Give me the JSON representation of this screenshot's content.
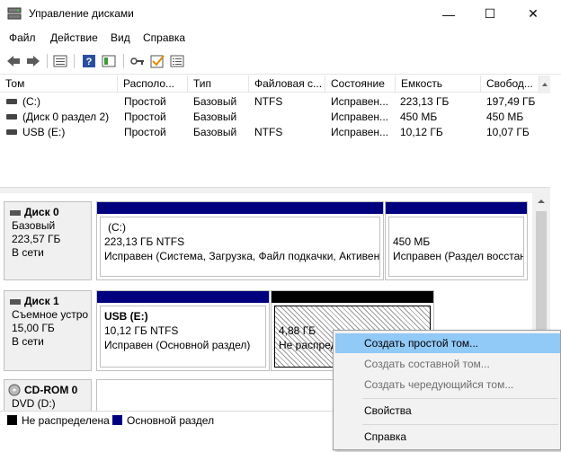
{
  "window": {
    "title": "Управление дисками",
    "minimize": "—",
    "maximize": "☐",
    "close": "✕"
  },
  "menu": [
    "Файл",
    "Действие",
    "Вид",
    "Справка"
  ],
  "toolbar": [
    "back-icon",
    "forward-icon",
    "properties-icon",
    "help-icon",
    "view-icon",
    "key-icon",
    "check-icon",
    "list-icon"
  ],
  "columns": [
    "Том",
    "Располо...",
    "Тип",
    "Файловая с...",
    "Состояние",
    "Емкость",
    "Свобод..."
  ],
  "volumes": [
    [
      "(C:)",
      "Простой",
      "Базовый",
      "NTFS",
      "Исправен...",
      "223,13 ГБ",
      "197,49 ГБ"
    ],
    [
      "(Диск 0 раздел 2)",
      "Простой",
      "Базовый",
      "",
      "Исправен...",
      "450 МБ",
      "450 МБ"
    ],
    [
      "USB (E:)",
      "Простой",
      "Базовый",
      "NTFS",
      "Исправен...",
      "10,12 ГБ",
      "10,07 ГБ"
    ]
  ],
  "disks": {
    "disk0": {
      "name": "Диск 0",
      "type": "Базовый",
      "size": "223,57 ГБ",
      "status": "В сети"
    },
    "disk1": {
      "name": "Диск 1",
      "type": "Съемное устро",
      "size": "15,00 ГБ",
      "status": "В сети"
    },
    "cdrom": {
      "name": "CD-ROM 0",
      "type": "DVD (D:)"
    }
  },
  "partitions": {
    "c": {
      "label": "(C:)",
      "fs": "223,13 ГБ NTFS",
      "status": "Исправен (Система, Загрузка, Файл подкачки, Активен,"
    },
    "p2": {
      "label": "",
      "fs": "450 МБ",
      "status": "Исправен (Раздел восстан"
    },
    "usb": {
      "label": "USB  (E:)",
      "fs": "10,12 ГБ NTFS",
      "status": "Исправен (Основной раздел)"
    },
    "unalloc": {
      "size": "4,88 ГБ",
      "status": "Не распред"
    }
  },
  "legend": {
    "unallocated": "Не распределена",
    "primary": "Основной раздел"
  },
  "context_menu": {
    "create_simple": "Создать простой том...",
    "create_spanned": "Создать составной том...",
    "create_striped": "Создать чередующийся том...",
    "properties": "Свойства",
    "help": "Справка"
  },
  "colors": {
    "primary": "#00007f",
    "unallocated": "#000000",
    "hover": "#91c9f7"
  }
}
